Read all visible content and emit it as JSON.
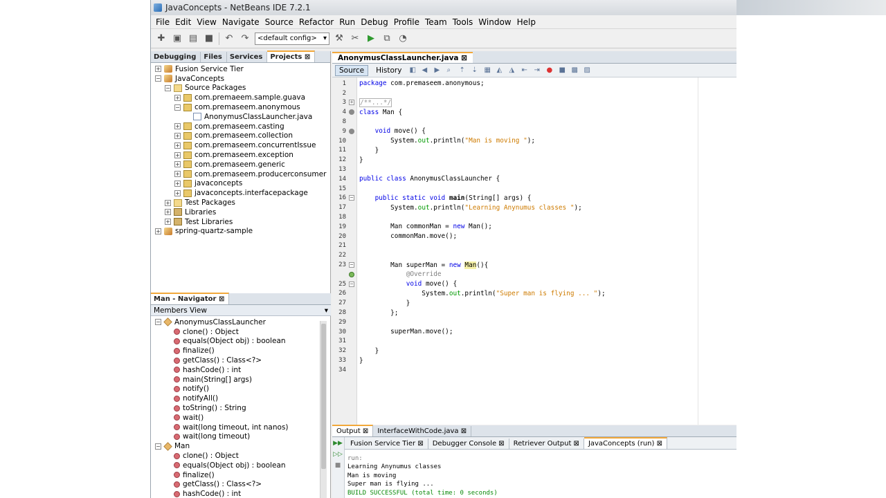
{
  "window": {
    "title": "JavaConcepts - NetBeans IDE 7.2.1"
  },
  "menu": [
    "File",
    "Edit",
    "View",
    "Navigate",
    "Source",
    "Refactor",
    "Run",
    "Debug",
    "Profile",
    "Team",
    "Tools",
    "Window",
    "Help"
  ],
  "toolbar": {
    "config_value": "<default config>"
  },
  "left_tabs": [
    "Debugging",
    "Files",
    "Services",
    "Projects"
  ],
  "projects_tree": [
    {
      "level": 0,
      "exp": "+",
      "icon": "proj",
      "label": "Fusion Service Tier"
    },
    {
      "level": 0,
      "exp": "−",
      "icon": "proj",
      "label": "JavaConcepts"
    },
    {
      "level": 1,
      "exp": "−",
      "icon": "folder",
      "label": "Source Packages"
    },
    {
      "level": 2,
      "exp": "+",
      "icon": "pkg",
      "label": "com.premaeem.sample.guava"
    },
    {
      "level": 2,
      "exp": "−",
      "icon": "pkg",
      "label": "com.premaseem.anonymous"
    },
    {
      "level": 3,
      "exp": "",
      "icon": "java",
      "label": "AnonymusClassLauncher.java"
    },
    {
      "level": 2,
      "exp": "+",
      "icon": "pkg",
      "label": "com.premaseem.casting"
    },
    {
      "level": 2,
      "exp": "+",
      "icon": "pkg",
      "label": "com.premaseem.collection"
    },
    {
      "level": 2,
      "exp": "+",
      "icon": "pkg",
      "label": "com.premaseem.concurrentIssue"
    },
    {
      "level": 2,
      "exp": "+",
      "icon": "pkg",
      "label": "com.premaseem.exception"
    },
    {
      "level": 2,
      "exp": "+",
      "icon": "pkg",
      "label": "com.premaseem.generic"
    },
    {
      "level": 2,
      "exp": "+",
      "icon": "pkg",
      "label": "com.premaseem.producerconsumer"
    },
    {
      "level": 2,
      "exp": "+",
      "icon": "pkg",
      "label": "javaconcepts"
    },
    {
      "level": 2,
      "exp": "+",
      "icon": "pkg",
      "label": "javaconcepts.interfacepackage"
    },
    {
      "level": 1,
      "exp": "+",
      "icon": "folder",
      "label": "Test Packages"
    },
    {
      "level": 1,
      "exp": "+",
      "icon": "lib",
      "label": "Libraries"
    },
    {
      "level": 1,
      "exp": "+",
      "icon": "lib",
      "label": "Test Libraries"
    },
    {
      "level": 0,
      "exp": "+",
      "icon": "proj",
      "label": "spring-quartz-sample"
    }
  ],
  "navigator": {
    "tab": "Man - Navigator",
    "view": "Members View",
    "items": [
      {
        "level": 0,
        "exp": "−",
        "icon": "cls",
        "label": "AnonymusClassLauncher"
      },
      {
        "level": 1,
        "icon": "meth",
        "label": "clone() : Object"
      },
      {
        "level": 1,
        "icon": "meth",
        "label": "equals(Object obj) : boolean"
      },
      {
        "level": 1,
        "icon": "meth",
        "label": "finalize()"
      },
      {
        "level": 1,
        "icon": "meth",
        "label": "getClass() : Class<?>"
      },
      {
        "level": 1,
        "icon": "meth",
        "label": "hashCode() : int"
      },
      {
        "level": 1,
        "icon": "meth",
        "label": "main(String[] args)"
      },
      {
        "level": 1,
        "icon": "meth",
        "label": "notify()"
      },
      {
        "level": 1,
        "icon": "meth",
        "label": "notifyAll()"
      },
      {
        "level": 1,
        "icon": "meth",
        "label": "toString() : String"
      },
      {
        "level": 1,
        "icon": "meth",
        "label": "wait()"
      },
      {
        "level": 1,
        "icon": "meth",
        "label": "wait(long timeout, int nanos)"
      },
      {
        "level": 1,
        "icon": "meth",
        "label": "wait(long timeout)"
      },
      {
        "level": 0,
        "exp": "−",
        "icon": "cls",
        "label": "Man"
      },
      {
        "level": 1,
        "icon": "meth",
        "label": "clone() : Object"
      },
      {
        "level": 1,
        "icon": "meth",
        "label": "equals(Object obj) : boolean"
      },
      {
        "level": 1,
        "icon": "meth",
        "label": "finalize()"
      },
      {
        "level": 1,
        "icon": "meth",
        "label": "getClass() : Class<?>"
      },
      {
        "level": 1,
        "icon": "meth",
        "label": "hashCode() : int"
      }
    ]
  },
  "editor": {
    "tab": "AnonymusClassLauncher.java",
    "source_label": "Source",
    "history_label": "History",
    "lines": [
      {
        "n": "1",
        "mark": "",
        "html": "<span class='kw'>package</span> com.premaseem.anonymous;"
      },
      {
        "n": "2",
        "mark": "",
        "html": ""
      },
      {
        "n": "3",
        "mark": "fold+",
        "html": "<span class='cmt'>/**...*/</span>"
      },
      {
        "n": "4",
        "mark": "ov",
        "html": "<span class='kw'>class</span> Man {"
      },
      {
        "n": "8",
        "mark": "",
        "html": ""
      },
      {
        "n": "9",
        "mark": "ovfold",
        "html": "    <span class='kw'>void</span> move() {"
      },
      {
        "n": "10",
        "mark": "",
        "html": "        System.<span class='fld'>out</span>.println(<span class='str'>\"Man is moving \"</span>);"
      },
      {
        "n": "11",
        "mark": "",
        "html": "    }"
      },
      {
        "n": "12",
        "mark": "",
        "html": "}"
      },
      {
        "n": "13",
        "mark": "",
        "html": ""
      },
      {
        "n": "14",
        "mark": "",
        "html": "<span class='kw'>public class</span> AnonymusClassLauncher {"
      },
      {
        "n": "15",
        "mark": "",
        "html": ""
      },
      {
        "n": "16",
        "mark": "fold-",
        "html": "    <span class='kw'>public static void</span> <b>main</b>(String[] args) {"
      },
      {
        "n": "17",
        "mark": "",
        "html": "        System.<span class='fld'>out</span>.println(<span class='str'>\"Learning Anynumus classes \"</span>);"
      },
      {
        "n": "18",
        "mark": "",
        "html": ""
      },
      {
        "n": "19",
        "mark": "",
        "html": "        Man commonMan = <span class='kw'>new</span> Man();"
      },
      {
        "n": "20",
        "mark": "",
        "html": "        commonMan.move();"
      },
      {
        "n": "21",
        "mark": "",
        "html": ""
      },
      {
        "n": "22",
        "mark": "",
        "html": ""
      },
      {
        "n": "23",
        "mark": "fold-",
        "html": "        Man superMan = <span class='kw'>new</span> <span class='hl'>Man</span>(){"
      },
      {
        "n": "",
        "mark": "ovg",
        "html": "            <span class='ann'>@Override</span>"
      },
      {
        "n": "25",
        "mark": "fold-",
        "html": "            <span class='kw'>void</span> move() {"
      },
      {
        "n": "26",
        "mark": "",
        "html": "                System.<span class='fld'>out</span>.println(<span class='str'>\"Super man is flying ... \"</span>);"
      },
      {
        "n": "27",
        "mark": "",
        "html": "            }"
      },
      {
        "n": "28",
        "mark": "",
        "html": "        };"
      },
      {
        "n": "29",
        "mark": "",
        "html": ""
      },
      {
        "n": "30",
        "mark": "",
        "html": "        superMan.move();"
      },
      {
        "n": "31",
        "mark": "",
        "html": ""
      },
      {
        "n": "32",
        "mark": "",
        "html": "    }"
      },
      {
        "n": "33",
        "mark": "",
        "html": "}"
      },
      {
        "n": "34",
        "mark": "",
        "html": ""
      }
    ]
  },
  "output": {
    "tabs": [
      "Output",
      "InterfaceWithCode.java"
    ],
    "subtabs": [
      "Fusion Service Tier",
      "Debugger Console",
      "Retriever Output",
      "JavaConcepts (run)"
    ],
    "lines": [
      "run:",
      "Learning Anynumus classes",
      "Man is moving",
      "Super man is flying ...",
      "BUILD SUCCESSFUL (total time: 0 seconds)"
    ]
  }
}
